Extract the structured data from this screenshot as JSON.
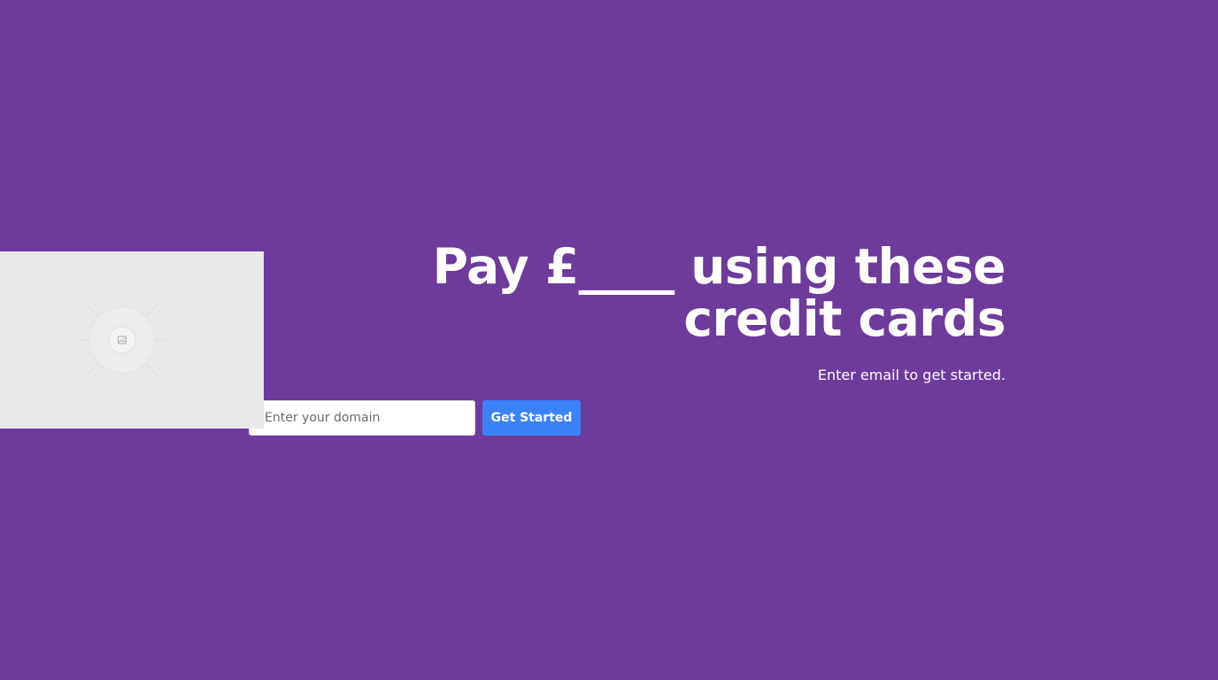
{
  "colors": {
    "background": "#6c3b9c",
    "button": "#3b82f6",
    "placeholder_image": "#e9e9e9"
  },
  "hero": {
    "heading": "Pay £____ using these credit cards",
    "subtext": "Enter email to get started."
  },
  "form": {
    "domain_placeholder": "Enter your domain",
    "domain_value": "",
    "submit_label": "Get Started"
  },
  "image": {
    "icon": "image-placeholder-icon"
  }
}
